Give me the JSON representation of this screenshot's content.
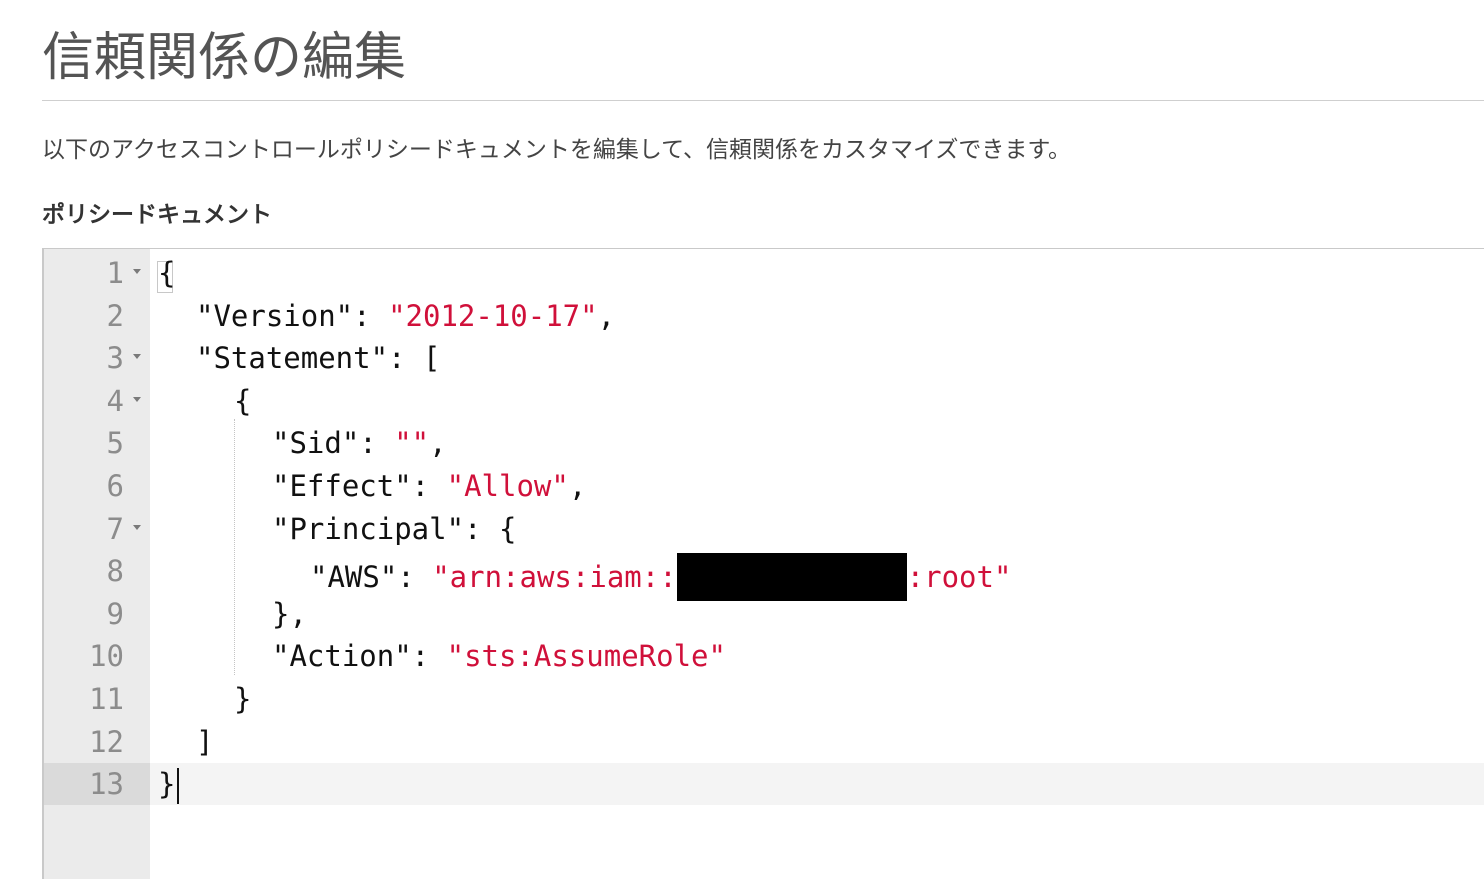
{
  "page": {
    "title": "信頼関係の編集",
    "description": "以下のアクセスコントロールポリシードキュメントを編集して、信頼関係をカスタマイズできます。",
    "section_label": "ポリシードキュメント"
  },
  "editor": {
    "lines": [
      {
        "number": "1",
        "indent": 0,
        "foldable": true,
        "parts": [
          {
            "text": "{",
            "type": "punct"
          }
        ]
      },
      {
        "number": "2",
        "indent": 1,
        "foldable": false,
        "parts": [
          {
            "text": "\"Version\": ",
            "type": "key"
          },
          {
            "text": "\"2012-10-17\"",
            "type": "string"
          },
          {
            "text": ",",
            "type": "punct"
          }
        ]
      },
      {
        "number": "3",
        "indent": 1,
        "foldable": true,
        "parts": [
          {
            "text": "\"Statement\": [",
            "type": "key"
          }
        ]
      },
      {
        "number": "4",
        "indent": 2,
        "foldable": true,
        "parts": [
          {
            "text": "{",
            "type": "punct"
          }
        ]
      },
      {
        "number": "5",
        "indent": 3,
        "foldable": false,
        "parts": [
          {
            "text": "\"Sid\": ",
            "type": "key"
          },
          {
            "text": "\"\"",
            "type": "string"
          },
          {
            "text": ",",
            "type": "punct"
          }
        ]
      },
      {
        "number": "6",
        "indent": 3,
        "foldable": false,
        "parts": [
          {
            "text": "\"Effect\": ",
            "type": "key"
          },
          {
            "text": "\"Allow\"",
            "type": "string"
          },
          {
            "text": ",",
            "type": "punct"
          }
        ]
      },
      {
        "number": "7",
        "indent": 3,
        "foldable": true,
        "parts": [
          {
            "text": "\"Principal\": {",
            "type": "key"
          }
        ]
      },
      {
        "number": "8",
        "indent": 4,
        "foldable": false,
        "parts": [
          {
            "text": "\"AWS\": ",
            "type": "key"
          },
          {
            "text": "\"arn:aws:iam::",
            "type": "string"
          },
          {
            "text": "",
            "type": "redacted"
          },
          {
            "text": ":root\"",
            "type": "string"
          }
        ]
      },
      {
        "number": "9",
        "indent": 3,
        "foldable": false,
        "parts": [
          {
            "text": "},",
            "type": "punct"
          }
        ]
      },
      {
        "number": "10",
        "indent": 3,
        "foldable": false,
        "parts": [
          {
            "text": "\"Action\": ",
            "type": "key"
          },
          {
            "text": "\"sts:AssumeRole\"",
            "type": "string"
          }
        ]
      },
      {
        "number": "11",
        "indent": 2,
        "foldable": false,
        "parts": [
          {
            "text": "}",
            "type": "punct"
          }
        ]
      },
      {
        "number": "12",
        "indent": 1,
        "foldable": false,
        "parts": [
          {
            "text": "]",
            "type": "punct"
          }
        ]
      },
      {
        "number": "13",
        "indent": 0,
        "foldable": false,
        "active": true,
        "parts": [
          {
            "text": "}",
            "type": "punct"
          }
        ]
      }
    ],
    "string_color": "#d0103a",
    "text_color": "#111111",
    "gutter_color": "#ebebeb"
  }
}
